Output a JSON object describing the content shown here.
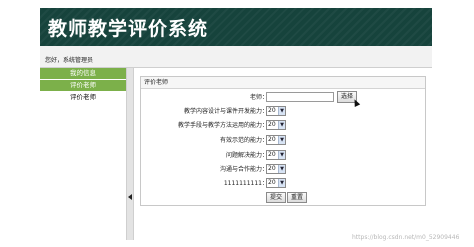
{
  "header": {
    "title": "教师教学评价系统"
  },
  "userbar": {
    "text": "您好，系统管理员"
  },
  "sidebar": {
    "items": [
      {
        "label": "我的信息"
      },
      {
        "label": "评价老师"
      },
      {
        "label": "评价老师"
      }
    ]
  },
  "panel": {
    "title": "评价老师",
    "teacher_label": "老师：",
    "teacher_value": "",
    "select_button": "选择",
    "criteria": [
      {
        "label": "教学内容设计与课件开发能力：",
        "value": "20"
      },
      {
        "label": "教学手段与教学方法运用的能力：",
        "value": "20"
      },
      {
        "label": "有效示范的能力：",
        "value": "20"
      },
      {
        "label": "问题解决能力：",
        "value": "20"
      },
      {
        "label": "沟通与合作能力：",
        "value": "20"
      },
      {
        "label": "1111111111：",
        "value": "20"
      }
    ],
    "submit_label": "提交",
    "reset_label": "重置"
  },
  "watermark": "https://blog.csdn.net/m0_52909446"
}
